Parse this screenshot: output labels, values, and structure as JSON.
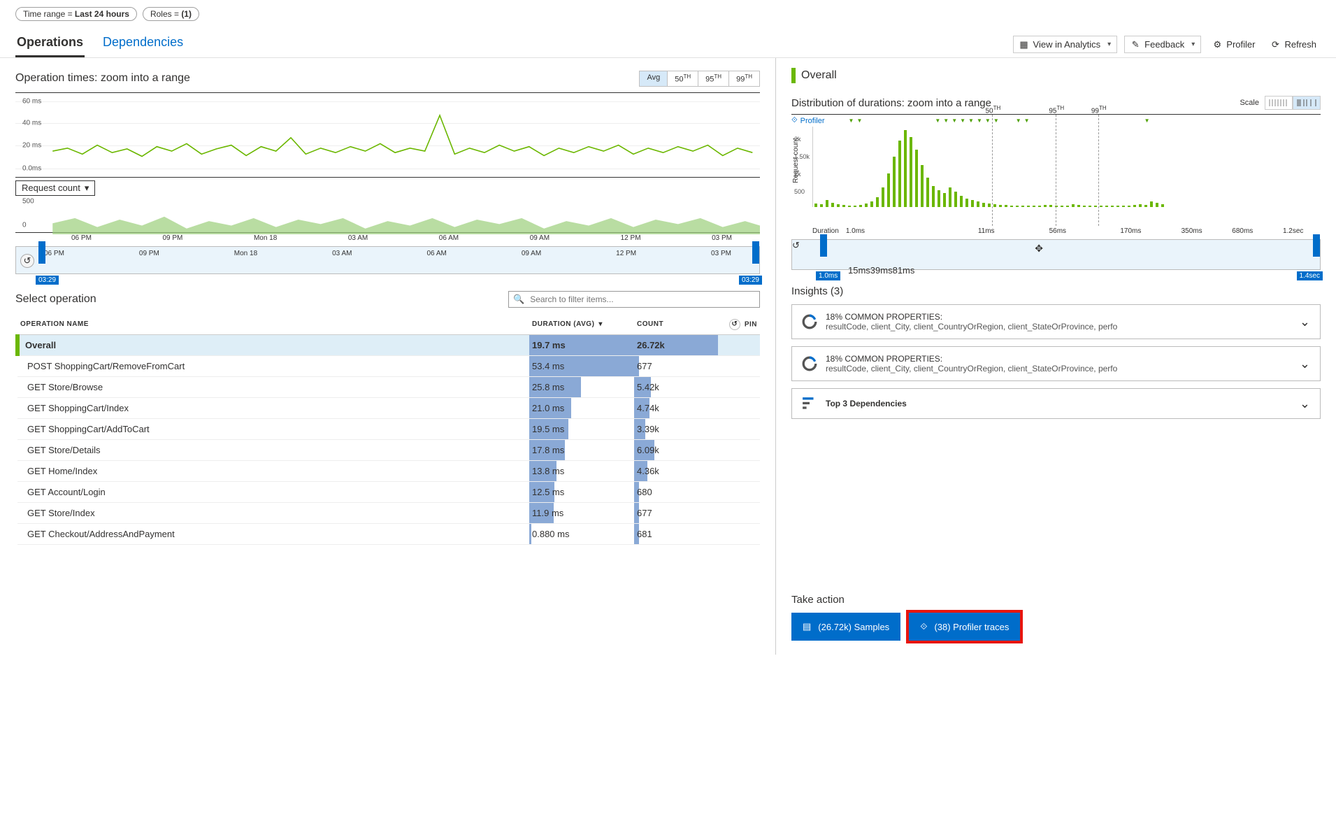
{
  "filters": {
    "time_range_key": "Time range = ",
    "time_range_val": "Last 24 hours",
    "roles_key": "Roles = ",
    "roles_val": "(1)"
  },
  "tabs": {
    "operations": "Operations",
    "dependencies": "Dependencies"
  },
  "actions": {
    "analytics": "View in Analytics",
    "feedback": "Feedback",
    "profiler": "Profiler",
    "refresh": "Refresh"
  },
  "op_times": {
    "title": "Operation times: zoom into a range",
    "toggles": [
      "Avg",
      "50",
      "95",
      "99"
    ],
    "th_suffix": "TH",
    "yticks": [
      "60 ms",
      "40 ms",
      "20 ms",
      "0.0ms"
    ],
    "request_dd": "Request count",
    "req_ytick": "500",
    "req_ytick0": "0",
    "xticks": [
      "06 PM",
      "09 PM",
      "Mon 18",
      "03 AM",
      "06 AM",
      "09 AM",
      "12 PM",
      "03 PM"
    ],
    "slider_start": "03:29",
    "slider_end": "03:29"
  },
  "select_op": {
    "title": "Select operation",
    "search_ph": "Search to filter items...",
    "col_name": "OPERATION NAME",
    "col_dur": "DURATION (AVG)",
    "col_count": "COUNT",
    "col_pin": "PIN",
    "rows": [
      {
        "n": "Overall",
        "d": "19.7 ms",
        "c": "26.72k",
        "db": 100,
        "cb": 100,
        "ov": true
      },
      {
        "n": "POST ShoppingCart/RemoveFromCart",
        "d": "53.4 ms",
        "c": "677",
        "db": 100,
        "cb": 6
      },
      {
        "n": "GET Store/Browse",
        "d": "25.8 ms",
        "c": "5.42k",
        "db": 49,
        "cb": 20
      },
      {
        "n": "GET ShoppingCart/Index",
        "d": "21.0 ms",
        "c": "4.74k",
        "db": 40,
        "cb": 18
      },
      {
        "n": "GET ShoppingCart/AddToCart",
        "d": "19.5 ms",
        "c": "3.39k",
        "db": 37,
        "cb": 13
      },
      {
        "n": "GET Store/Details",
        "d": "17.8 ms",
        "c": "6.09k",
        "db": 34,
        "cb": 24
      },
      {
        "n": "GET Home/Index",
        "d": "13.8 ms",
        "c": "4.36k",
        "db": 26,
        "cb": 16
      },
      {
        "n": "GET Account/Login",
        "d": "12.5 ms",
        "c": "680",
        "db": 24,
        "cb": 6
      },
      {
        "n": "GET Store/Index",
        "d": "11.9 ms",
        "c": "677",
        "db": 23,
        "cb": 6
      },
      {
        "n": "GET Checkout/AddressAndPayment",
        "d": "0.880 ms",
        "c": "681",
        "db": 2,
        "cb": 6
      }
    ]
  },
  "overall": "Overall",
  "dist": {
    "title": "Distribution of durations: zoom into a range",
    "scale": "Scale",
    "profiler": "Profiler",
    "ylabel": "Request count",
    "yticks": [
      "2k",
      "1.50k",
      "1k",
      "500"
    ],
    "pct": [
      "50",
      "95",
      "99"
    ],
    "xlabel": "Duration",
    "xticks": [
      "1.0ms",
      "11ms",
      "56ms",
      "170ms",
      "350ms",
      "680ms",
      "1.2sec"
    ],
    "slider_ticks": [
      "15ms",
      "39ms",
      "81ms"
    ],
    "slider_start": "1.0ms",
    "slider_end": "1.4sec"
  },
  "insights": {
    "title": "Insights (3)",
    "c1_hdr": "18% COMMON PROPERTIES:",
    "c1_sub": "resultCode, client_City, client_CountryOrRegion, client_StateOrProvince, perfo",
    "c2_hdr": "18% COMMON PROPERTIES:",
    "c2_sub": "resultCode, client_City, client_CountryOrRegion, client_StateOrProvince, perfo",
    "c3": "Top 3 Dependencies"
  },
  "take_action": {
    "title": "Take action",
    "samples": "(26.72k) Samples",
    "traces": "(38) Profiler traces"
  },
  "chart_data": {
    "operation_times_line": {
      "type": "line",
      "ylim": [
        0,
        60
      ],
      "yunit": "ms",
      "x_range": "Last 24 hours",
      "note": "jittery green line around ~20ms with one spike near 50ms"
    },
    "request_count_area": {
      "type": "area",
      "ylim": [
        0,
        500
      ],
      "note": "green area fluctuating roughly 100–250"
    },
    "duration_histogram": {
      "type": "bar",
      "xlabel": "Duration",
      "ylabel": "Request count",
      "categories": [
        "1.0ms",
        "11ms",
        "56ms",
        "170ms",
        "350ms",
        "680ms",
        "1.2sec"
      ],
      "peak_at": "11ms",
      "percentiles": {
        "50": "~11ms",
        "95": "~56ms",
        "99": "~80ms"
      },
      "ylim": [
        0,
        2000
      ]
    }
  }
}
